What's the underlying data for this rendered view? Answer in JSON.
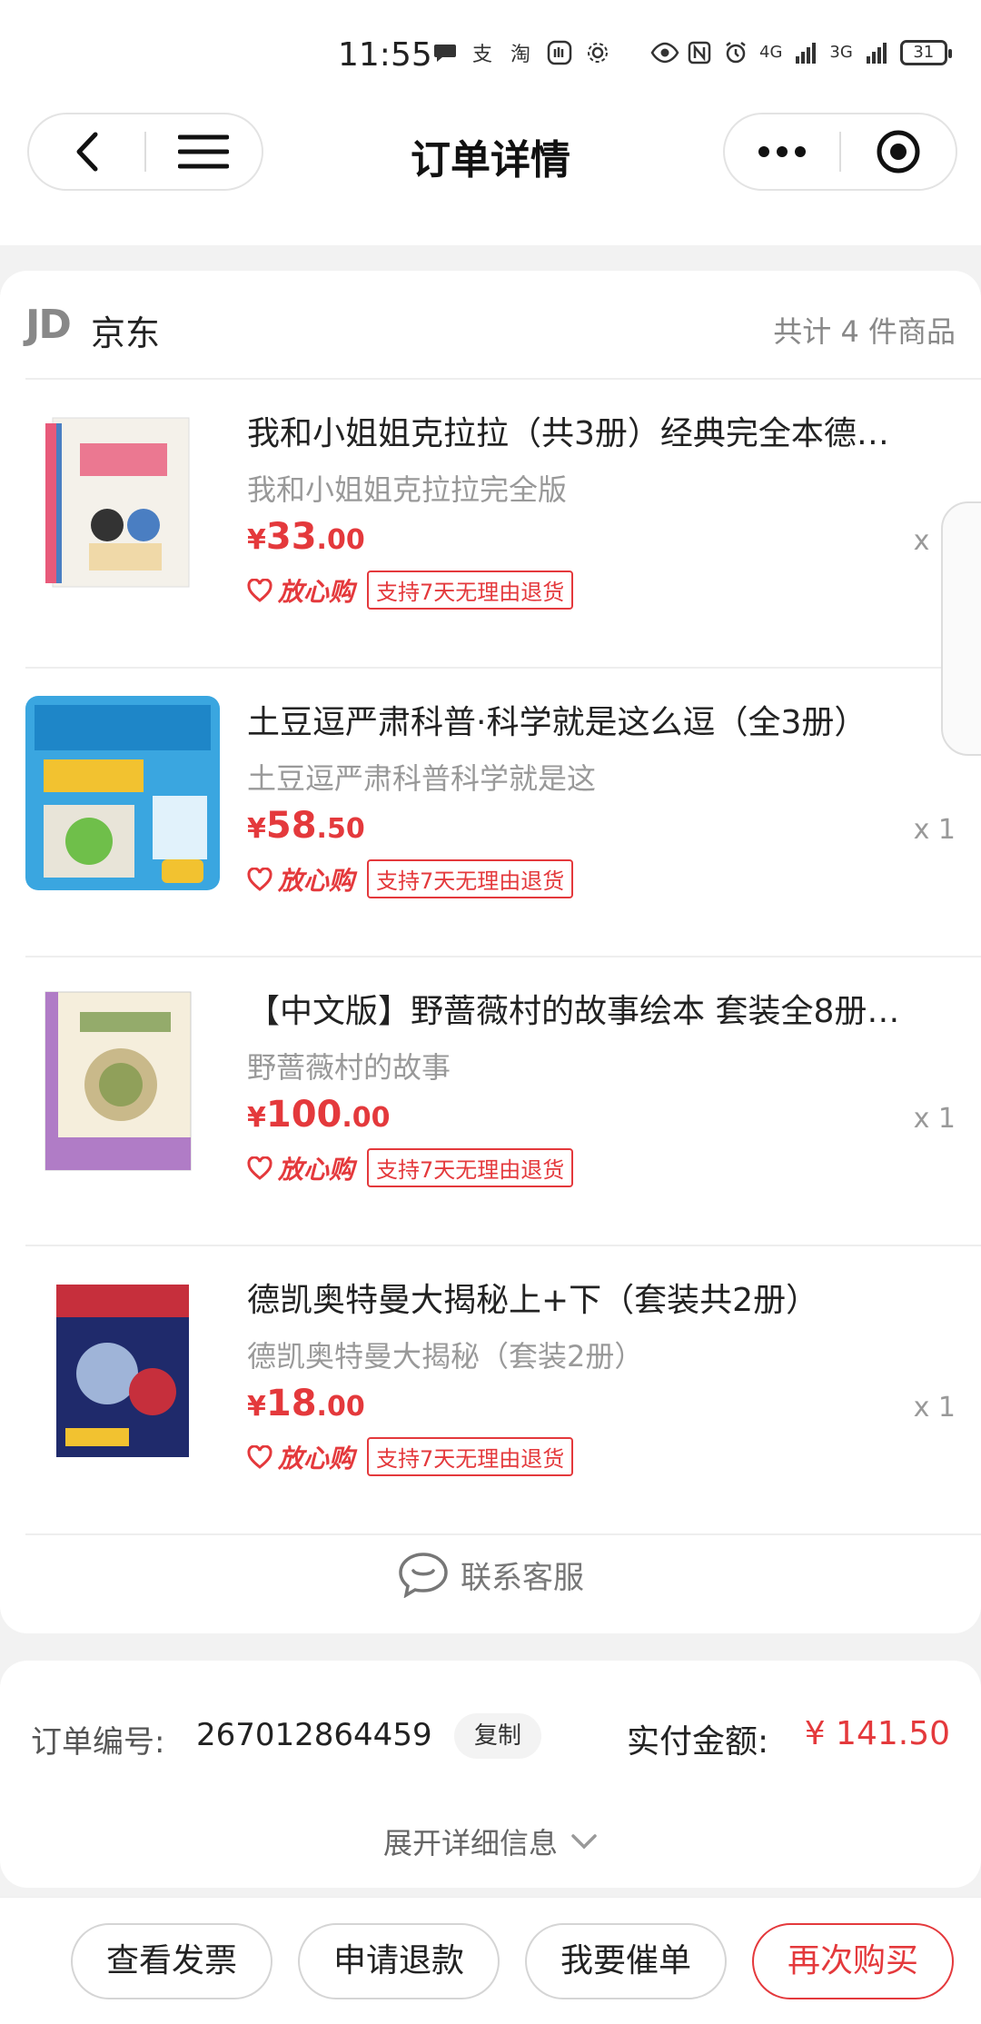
{
  "status_bar": {
    "time": "11:55",
    "battery": "31",
    "network_left": "4G",
    "network_right": "3G"
  },
  "nav": {
    "title": "订单详情"
  },
  "shop": {
    "logo": "JD",
    "name": "京东",
    "count": "共计 4 件商品"
  },
  "items": [
    {
      "title": "我和小姐姐克拉拉（共3册）经典完全本德…",
      "subtitle": "我和小姐姐克拉拉完全版",
      "price_symbol": "¥",
      "price_int": "33",
      "price_dec": ".00",
      "qty": "x 1",
      "assure": "放心购",
      "return_tag": "支持7天无理由退货",
      "thumb_colors": [
        "#f4f1ea",
        "#e85a7a",
        "#4a7ec2"
      ]
    },
    {
      "title": "土豆逗严肃科普·科学就是这么逗（全3册）",
      "subtitle": "土豆逗严肃科普科学就是这",
      "price_symbol": "¥",
      "price_int": "58",
      "price_dec": ".50",
      "qty": "x 1",
      "assure": "放心购",
      "return_tag": "支持7天无理由退货",
      "thumb_colors": [
        "#3aa6e0",
        "#f2c230",
        "#e8e4d8"
      ]
    },
    {
      "title": "【中文版】野蔷薇村的故事绘本 套装全8册…",
      "subtitle": "野蔷薇村的故事",
      "price_symbol": "¥",
      "price_int": "100",
      "price_dec": ".00",
      "qty": "x 1",
      "assure": "放心购",
      "return_tag": "支持7天无理由退货",
      "thumb_colors": [
        "#f5eedc",
        "#b07cc6",
        "#6b8f3a"
      ]
    },
    {
      "title": "德凯奥特曼大揭秘上+下（套装共2册）",
      "subtitle": "德凯奥特曼大揭秘（套装2册）",
      "price_symbol": "¥",
      "price_int": "18",
      "price_dec": ".00",
      "qty": "x 1",
      "assure": "放心购",
      "return_tag": "支持7天无理由退货",
      "thumb_colors": [
        "#1f2a6b",
        "#c62f3c",
        "#9fb4d8"
      ]
    }
  ],
  "service": {
    "label": "联系客服"
  },
  "order": {
    "number_label": "订单编号:",
    "number": "267012864459",
    "copy_label": "复制",
    "paid_label": "实付金额:",
    "paid_amount": "¥ 141.50",
    "expand_label": "展开详细信息"
  },
  "actions": {
    "invoice": "查看发票",
    "refund": "申请退款",
    "urge": "我要催单",
    "rebuy": "再次购买"
  },
  "colors": {
    "accent_red": "#e4393c",
    "muted_text": "#999999"
  }
}
